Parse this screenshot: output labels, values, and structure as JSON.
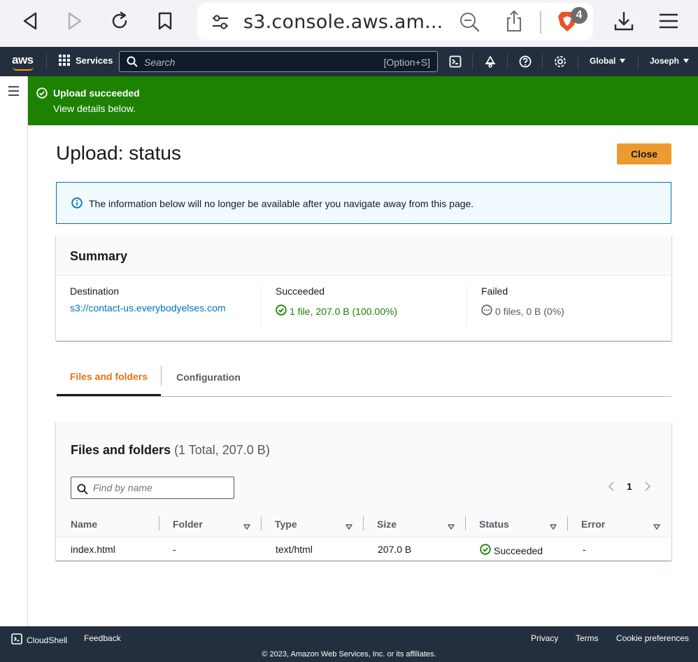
{
  "browser": {
    "url": "s3.console.aws.am...",
    "tab_count": "4"
  },
  "nav": {
    "logo": "aws",
    "services_label": "Services",
    "search_placeholder": "Search",
    "search_shortcut": "[Option+S]",
    "region": "Global",
    "user": "Joseph"
  },
  "flash": {
    "title": "Upload succeeded",
    "message": "View details below."
  },
  "page": {
    "title": "Upload: status",
    "close_label": "Close"
  },
  "info_alert": {
    "text": "The information below will no longer be available after you navigate away from this page."
  },
  "summary": {
    "title": "Summary",
    "destination_label": "Destination",
    "destination_value": "s3://contact-us.everybodyelses.com",
    "succeeded_label": "Succeeded",
    "succeeded_value": "1 file, 207.0 B (100.00%)",
    "failed_label": "Failed",
    "failed_value": "0 files, 0 B (0%)"
  },
  "tabs": [
    {
      "label": "Files and folders",
      "active": true
    },
    {
      "label": "Configuration",
      "active": false
    }
  ],
  "files": {
    "title": "Files and folders",
    "count": "(1 Total, 207.0 B)",
    "find_placeholder": "Find by name",
    "page_number": "1",
    "columns": [
      "Name",
      "Folder",
      "Type",
      "Size",
      "Status",
      "Error"
    ],
    "rows": [
      {
        "name": "index.html",
        "folder": "-",
        "type": "text/html",
        "size": "207.0 B",
        "status": "Succeeded",
        "error": "-"
      }
    ]
  },
  "footer": {
    "cloudshell": "CloudShell",
    "feedback": "Feedback",
    "privacy": "Privacy",
    "terms": "Terms",
    "cookie": "Cookie preferences",
    "copyright": "© 2023, Amazon Web Services, Inc. or its affiliates."
  },
  "colors": {
    "nav_bg": "#232f3e",
    "success_green": "#1d8102",
    "link_blue": "#0073bb",
    "primary_orange": "#ec9b30",
    "tab_active_orange": "#ec7211"
  }
}
